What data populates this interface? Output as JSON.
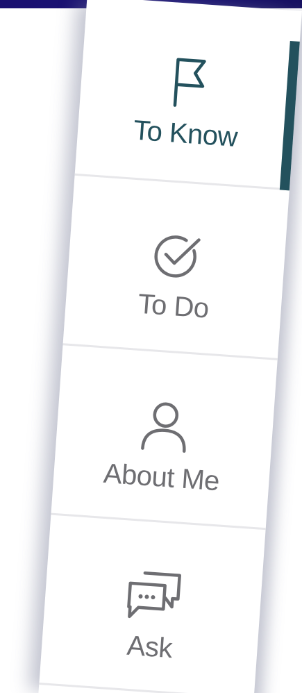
{
  "nav": {
    "active_index": 0,
    "accent_color": "#23515d",
    "inactive_color": "#6e6e72",
    "items": [
      {
        "label": "To Know",
        "icon": "flag-icon"
      },
      {
        "label": "To Do",
        "icon": "check-circle-icon"
      },
      {
        "label": "About Me",
        "icon": "user-icon"
      },
      {
        "label": "Ask",
        "icon": "chat-bubbles-icon"
      }
    ]
  }
}
